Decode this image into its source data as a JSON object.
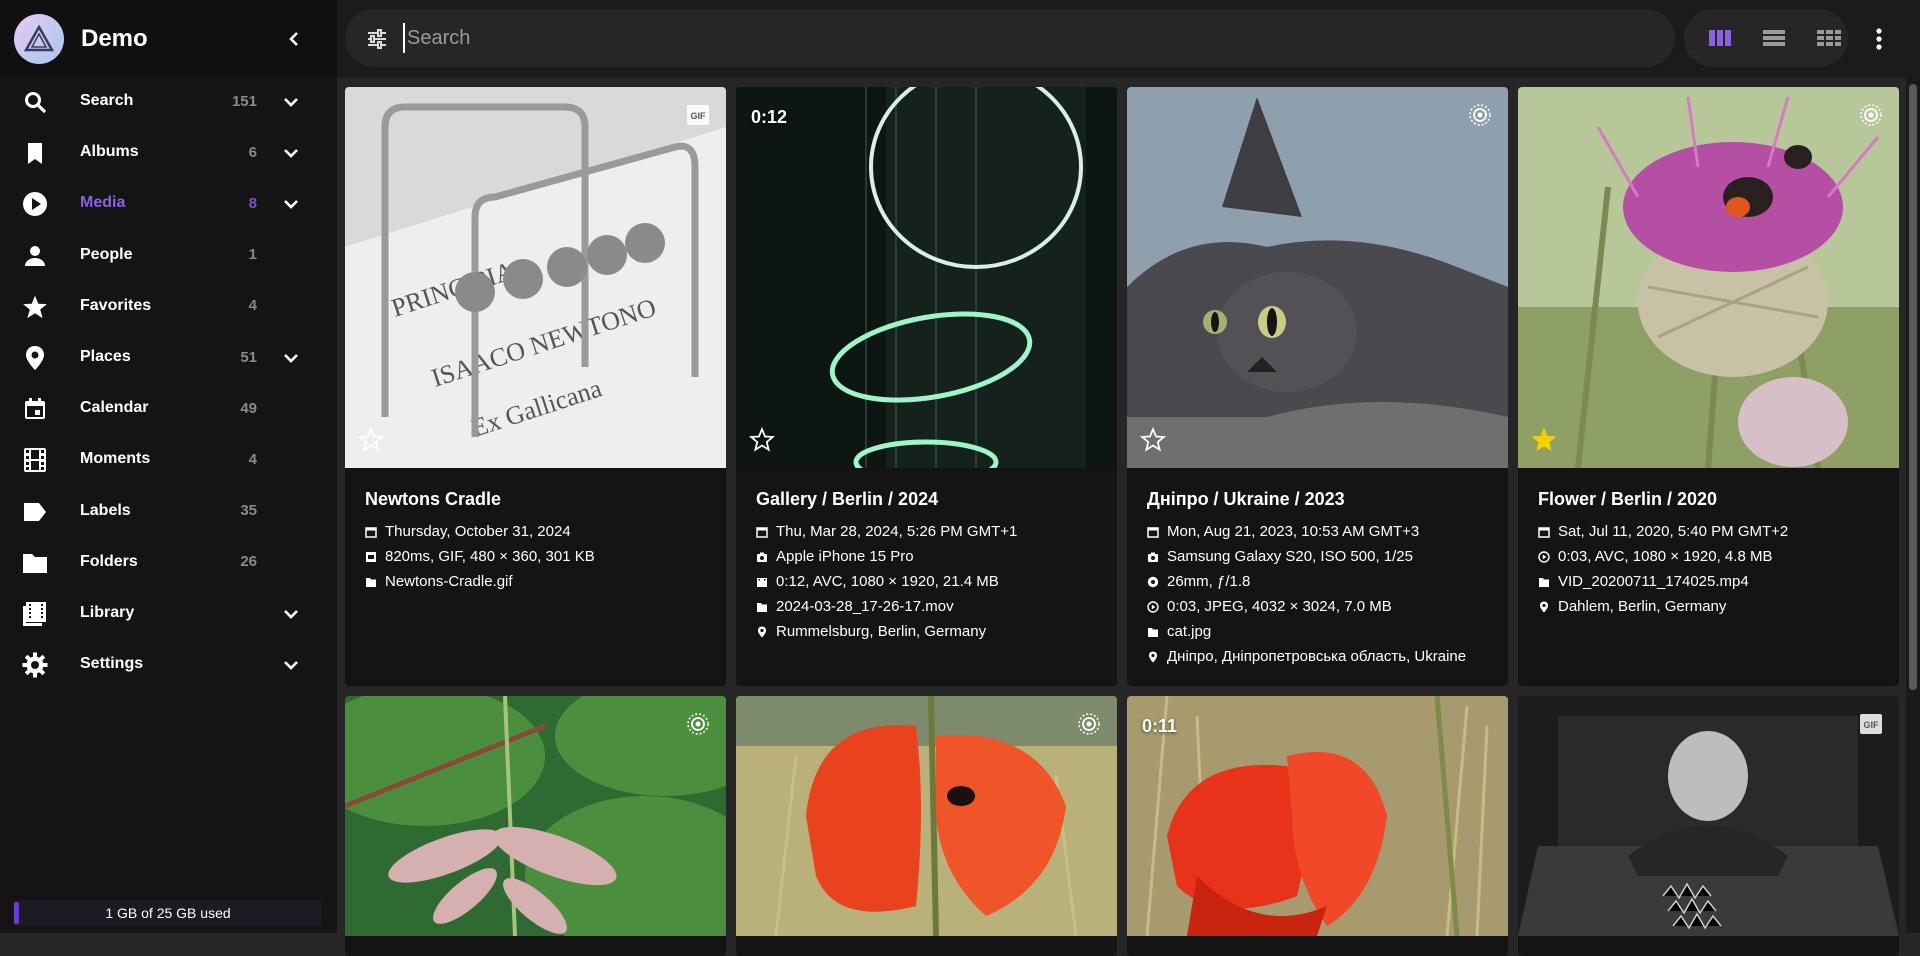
{
  "app": {
    "name": "Demo"
  },
  "colors": {
    "accent": "#8b62e0",
    "favorite": "#f5d000"
  },
  "sidebar": {
    "items": [
      {
        "label": "Search",
        "count": "151",
        "icon": "search-icon",
        "expandable": true
      },
      {
        "label": "Albums",
        "count": "6",
        "icon": "bookmark-icon",
        "expandable": true
      },
      {
        "label": "Media",
        "count": "8",
        "icon": "play-circle-icon",
        "expandable": true,
        "active": true
      },
      {
        "label": "People",
        "count": "1",
        "icon": "person-icon",
        "expandable": false
      },
      {
        "label": "Favorites",
        "count": "4",
        "icon": "star-icon",
        "expandable": false
      },
      {
        "label": "Places",
        "count": "51",
        "icon": "location-pin-icon",
        "expandable": true
      },
      {
        "label": "Calendar",
        "count": "49",
        "icon": "calendar-icon",
        "expandable": false
      },
      {
        "label": "Moments",
        "count": "4",
        "icon": "film-icon",
        "expandable": false
      },
      {
        "label": "Labels",
        "count": "35",
        "icon": "label-tag-icon",
        "expandable": false
      },
      {
        "label": "Folders",
        "count": "26",
        "icon": "folder-icon",
        "expandable": false
      },
      {
        "label": "Library",
        "count": "",
        "icon": "library-icon",
        "expandable": true
      },
      {
        "label": "Settings",
        "count": "",
        "icon": "gear-icon",
        "expandable": true
      }
    ],
    "storage": "1 GB of 25 GB used"
  },
  "search": {
    "placeholder": "Search"
  },
  "cards": [
    {
      "title": "Newtons Cradle",
      "badge": "GIF",
      "duration": "",
      "favorite": false,
      "meta": [
        {
          "icon": "calendar-icon",
          "text": "Thursday, October 31, 2024"
        },
        {
          "icon": "gif-icon",
          "text": "820ms, GIF, 480 × 360, 301 KB"
        },
        {
          "icon": "file-icon",
          "text": "Newtons-Cradle.gif"
        }
      ]
    },
    {
      "title": "Gallery / Berlin / 2024",
      "badge": "",
      "duration": "0:12",
      "favorite": false,
      "meta": [
        {
          "icon": "calendar-icon",
          "text": "Thu, Mar 28, 2024, 5:26 PM GMT+1"
        },
        {
          "icon": "camera-icon",
          "text": "Apple iPhone 15 Pro"
        },
        {
          "icon": "video-icon",
          "text": "0:12, AVC, 1080 × 1920, 21.4 MB"
        },
        {
          "icon": "file-icon",
          "text": "2024-03-28_17-26-17.mov"
        },
        {
          "icon": "location-pin-icon",
          "text": "Rummelsburg, Berlin, Germany"
        }
      ]
    },
    {
      "title": "Дніпро / Ukraine / 2023",
      "badge": "LIVE",
      "duration": "",
      "favorite": false,
      "meta": [
        {
          "icon": "calendar-icon",
          "text": "Mon, Aug 21, 2023, 10:53 AM GMT+3"
        },
        {
          "icon": "camera-icon",
          "text": "Samsung Galaxy S20, ISO 500, 1/25"
        },
        {
          "icon": "aperture-icon",
          "text": "26mm, ƒ/1.8"
        },
        {
          "icon": "play-circle-icon",
          "text": "0:03, JPEG, 4032 × 3024, 7.0 MB"
        },
        {
          "icon": "file-icon",
          "text": "cat.jpg"
        },
        {
          "icon": "location-pin-icon",
          "text": "Дніпро, Дніпропетровська область, Ukraine"
        }
      ]
    },
    {
      "title": "Flower / Berlin / 2020",
      "badge": "LIVE",
      "duration": "",
      "favorite": true,
      "meta": [
        {
          "icon": "calendar-icon",
          "text": "Sat, Jul 11, 2020, 5:40 PM GMT+2"
        },
        {
          "icon": "play-circle-icon",
          "text": "0:03, AVC, 1080 × 1920, 4.8 MB"
        },
        {
          "icon": "file-icon",
          "text": "VID_20200711_174025.mp4"
        },
        {
          "icon": "location-pin-icon",
          "text": "Dahlem, Berlin, Germany"
        }
      ]
    },
    {
      "title": "",
      "badge": "LIVE",
      "duration": "",
      "favorite": false,
      "meta": []
    },
    {
      "title": "",
      "badge": "LIVE",
      "duration": "",
      "favorite": false,
      "meta": []
    },
    {
      "title": "",
      "badge": "",
      "duration": "0:11",
      "favorite": false,
      "meta": []
    },
    {
      "title": "",
      "badge": "GIF",
      "duration": "",
      "favorite": false,
      "meta": []
    }
  ]
}
